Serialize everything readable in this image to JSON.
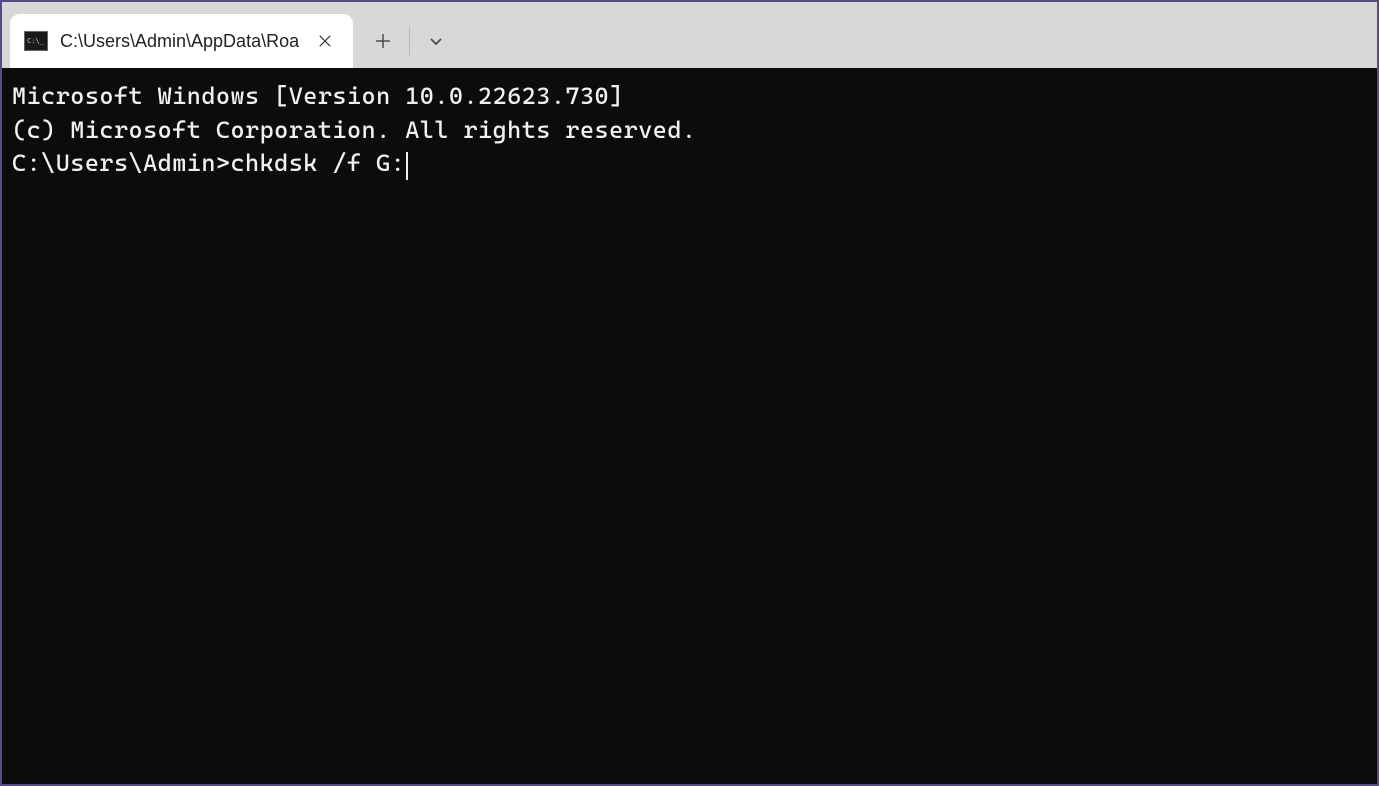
{
  "tab": {
    "title": "C:\\Users\\Admin\\AppData\\Roa",
    "icon_name": "cmd-icon"
  },
  "terminal": {
    "line1": "Microsoft Windows [Version 10.0.22623.730]",
    "line2": "(c) Microsoft Corporation. All rights reserved.",
    "blank": "",
    "prompt": "C:\\Users\\Admin>",
    "command": "chkdsk /f G:"
  },
  "icons": {
    "close": "close-icon",
    "new_tab": "plus-icon",
    "dropdown": "chevron-down-icon"
  }
}
